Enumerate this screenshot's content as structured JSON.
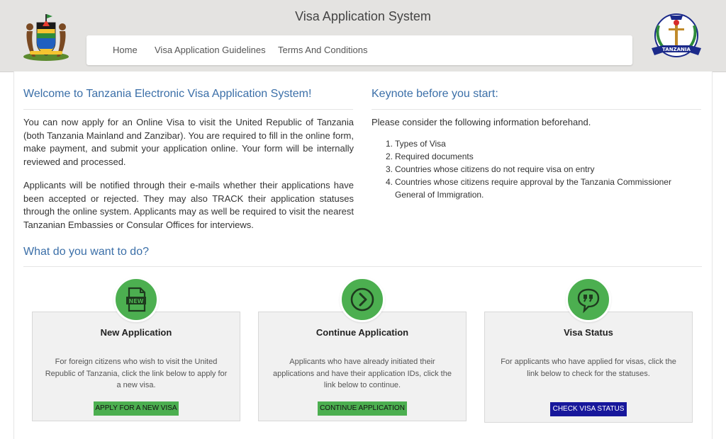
{
  "header": {
    "title": "Visa Application System",
    "nav": [
      "Home",
      "Visa Application Guidelines",
      "Terms And Conditions"
    ],
    "emblem_text": "TANZANIA"
  },
  "welcome": {
    "title": "Welcome to Tanzania Electronic Visa Application System!",
    "paragraphs": [
      "You can now apply for an Online Visa to visit the United Republic of Tanzania (both Tanzania Mainland and Zanzibar). You are required to fill in the online form, make payment, and submit your application online. Your form will be internally reviewed and processed.",
      "Applicants will be notified through their e-mails whether their applications have been accepted or rejected. They may also TRACK their application statuses through the online system. Applicants may as well be required to visit the nearest Tanzanian Embassies or Consular Offices for interviews."
    ]
  },
  "keynote": {
    "title": "Keynote before you start:",
    "intro": "Please consider the following information beforehand.",
    "items": [
      "Types of Visa",
      "Required documents",
      "Countries whose citizens do not require visa on entry",
      "Countries whose citizens require approval by the Tanzania Commissioner General of Immigration."
    ]
  },
  "actions": {
    "title": "What do you want to do?",
    "cards": [
      {
        "icon": "new-document-icon",
        "icon_text": "NEW",
        "title": "New Application",
        "description": "For foreign citizens who wish to visit the United Republic of Tanzania, click the link below to apply for a new visa.",
        "button": "APPLY FOR A NEW VISA"
      },
      {
        "icon": "arrow-right-circle-icon",
        "title": "Continue Application",
        "description": "Applicants who have already initiated their applications and have their application IDs, click the link below to continue.",
        "button": "CONTINUE APPLICATION"
      },
      {
        "icon": "quote-bubble-icon",
        "title": "Visa Status",
        "description": "For applicants who have applied for visas, click the link below to check for the statuses.",
        "button": "CHECK VISA STATUS"
      }
    ]
  },
  "colors": {
    "header_bg": "#e4e3e1",
    "heading_blue": "#3b6fa8",
    "green": "#4caf50",
    "status_button": "#17179b"
  }
}
